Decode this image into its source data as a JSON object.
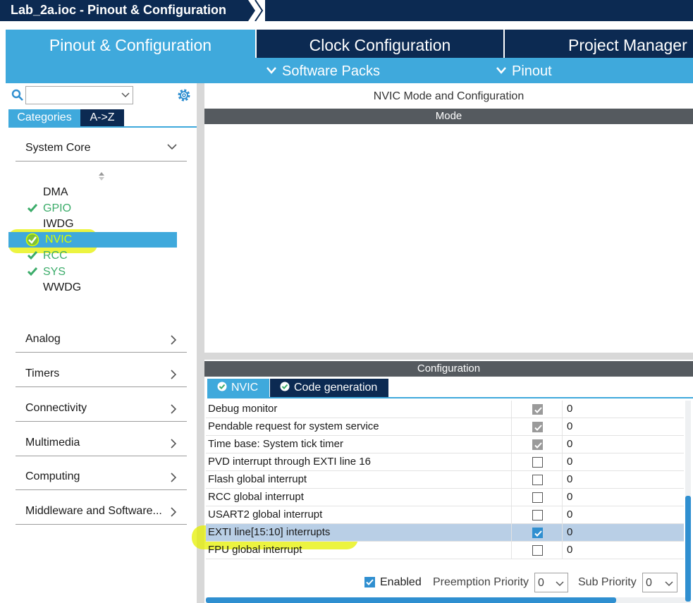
{
  "window": {
    "breadcrumb": "Lab_2a.ioc - Pinout & Configuration"
  },
  "tabs": {
    "pinout_config": "Pinout & Configuration",
    "clock_config": "Clock Configuration",
    "project_manager": "Project Manager"
  },
  "subtabs": {
    "software_packs": "Software Packs",
    "pinout": "Pinout"
  },
  "left": {
    "search": {
      "value": ""
    },
    "category_tabs": {
      "categories": "Categories",
      "az": "A->Z"
    },
    "system_core": {
      "label": "System Core",
      "items": [
        {
          "label": "DMA",
          "status": "none"
        },
        {
          "label": "GPIO",
          "status": "configured"
        },
        {
          "label": "IWDG",
          "status": "none"
        },
        {
          "label": "NVIC",
          "status": "configured-selected"
        },
        {
          "label": "RCC",
          "status": "configured"
        },
        {
          "label": "SYS",
          "status": "configured"
        },
        {
          "label": "WWDG",
          "status": "none"
        }
      ]
    },
    "sections": [
      "Analog",
      "Timers",
      "Connectivity",
      "Multimedia",
      "Computing",
      "Middleware and Software..."
    ]
  },
  "right": {
    "title": "NVIC Mode and Configuration",
    "mode_header": "Mode",
    "config_header": "Configuration",
    "config_tabs": {
      "nvic": "NVIC",
      "code_generation": "Code generation"
    },
    "table_rows": [
      {
        "name": "Debug monitor",
        "enabled": true,
        "locked": true,
        "priority": "0"
      },
      {
        "name": "Pendable request for system service",
        "enabled": true,
        "locked": true,
        "priority": "0"
      },
      {
        "name": "Time base: System tick timer",
        "enabled": true,
        "locked": true,
        "priority": "0"
      },
      {
        "name": "PVD interrupt through EXTI line 16",
        "enabled": false,
        "locked": false,
        "priority": "0"
      },
      {
        "name": "Flash global interrupt",
        "enabled": false,
        "locked": false,
        "priority": "0"
      },
      {
        "name": "RCC global interrupt",
        "enabled": false,
        "locked": false,
        "priority": "0"
      },
      {
        "name": "USART2 global interrupt",
        "enabled": false,
        "locked": false,
        "priority": "0"
      },
      {
        "name": "EXTI line[15:10] interrupts",
        "enabled": true,
        "locked": false,
        "priority": "0"
      },
      {
        "name": "FPU global interrupt",
        "enabled": false,
        "locked": false,
        "priority": "0"
      }
    ],
    "bottom": {
      "enabled_label": "Enabled",
      "preemption_label": "Preemption Priority",
      "preemption_value": "0",
      "sub_label": "Sub Priority",
      "sub_value": "0"
    }
  },
  "colors": {
    "accent": "#3fa9dc",
    "navy": "#0c2a52",
    "configured_green": "#3cac6a",
    "highlighter": "#e6f000"
  }
}
